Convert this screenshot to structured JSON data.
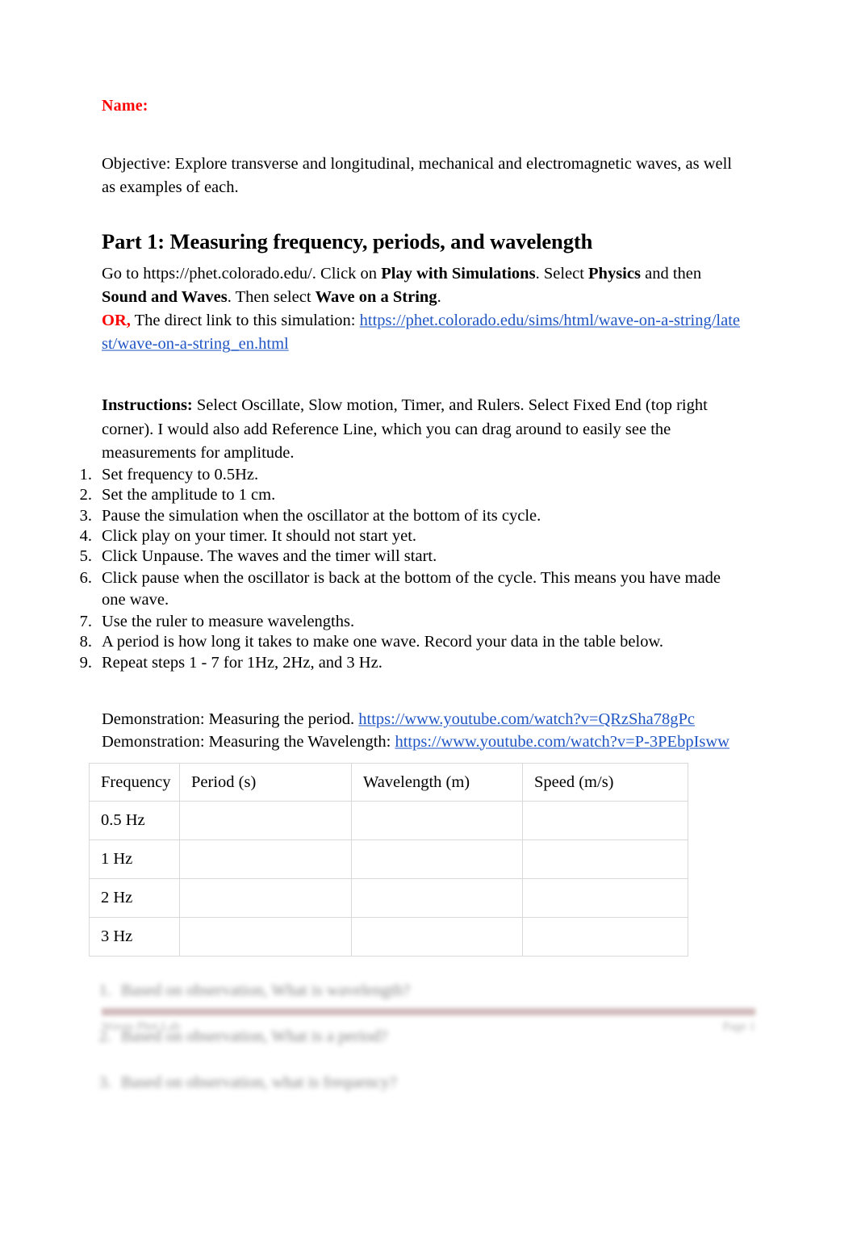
{
  "document": {
    "name_label": "Name:",
    "objective": "Objective: Explore transverse and longitudinal, mechanical and electromagnetic waves, as well as examples of each.",
    "part_heading": "Part 1: Measuring frequency, periods, and wavelength"
  },
  "intro": {
    "line1_a": "Go to https://phet.colorado.edu/. Click on ",
    "line1_b": "Play with Simulations",
    "line1_c": ". Select ",
    "line1_d": "Physics",
    "line1_e": " and then ",
    "line2_a": "Sound and Waves",
    "line2_b": ". Then select ",
    "line2_c": "Wave on a String",
    "line2_d": ".",
    "or_label": "OR,",
    "or_text": " The direct link to this simulation: ",
    "sim_link": "https://phet.colorado.edu/sims/html/wave-on-a-string/latest/wave-on-a-string_en.html"
  },
  "instructions": {
    "label": "Instructions:",
    "text": " Select Oscillate, Slow motion, Timer, and Rulers. Select Fixed End (top right corner). I would also add Reference Line, which you can drag around to easily see the measurements for amplitude.",
    "steps": [
      "Set frequency to 0.5Hz.",
      "Set the amplitude to 1 cm.",
      "Pause the simulation when the oscillator at the bottom of its cycle.",
      "Click play on your timer. It should not start yet.",
      "Click Unpause. The waves and the timer will start.",
      "Click pause when the oscillator is back at the bottom of the cycle. This means you have made one wave.",
      "Use the ruler to measure wavelengths.",
      "A period is how long it takes to make one wave.  Record your data in the table below.",
      "Repeat steps 1 - 7 for 1Hz, 2Hz, and 3 Hz."
    ]
  },
  "demonstrations": [
    {
      "label": "Demonstration: Measuring the period. ",
      "url": "https://www.youtube.com/watch?v=QRzSha78gPc"
    },
    {
      "label": "Demonstration: Measuring the Wavelength: ",
      "url": "https://www.youtube.com/watch?v=P-3PEbpIsww"
    }
  ],
  "table": {
    "headers": [
      "Frequency",
      "Period (s)",
      "Wavelength (m)",
      "Speed (m/s)"
    ],
    "rows": [
      [
        "0.5 Hz",
        "",
        "",
        ""
      ],
      [
        "1 Hz",
        "",
        "",
        ""
      ],
      [
        "2 Hz",
        "",
        "",
        ""
      ],
      [
        "3 Hz",
        "",
        "",
        ""
      ]
    ]
  },
  "blurred_questions": [
    {
      "num": "1.",
      "text": "Based on observation, What is wavelength?"
    },
    {
      "num": "2.",
      "text": "Based on observation, What is a period?"
    },
    {
      "num": "3.",
      "text": "Based on observation, what is frequency?"
    }
  ],
  "footer": {
    "left": "Waves Phet Lab",
    "right": "Page 1",
    "rule_color": "#c9aeae"
  }
}
